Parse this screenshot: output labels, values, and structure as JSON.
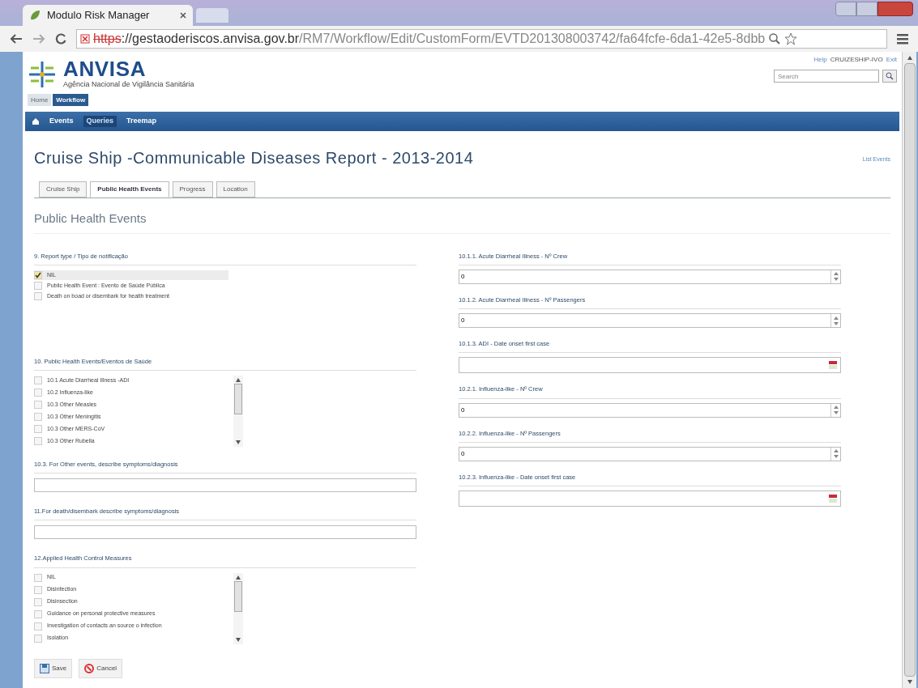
{
  "browser": {
    "tab_title": "Modulo Risk Manager",
    "url_scheme": "https",
    "url_host": "://gestaoderiscos.anvisa.gov.br",
    "url_path": "/RM7/Workflow/Edit/CustomForm/EVTD201308003742/fa64fcfe-6da1-42e5-8dbb"
  },
  "header": {
    "logo": "ANVISA",
    "subtitle": "Agência Nacional de Vigilância Sanitária",
    "help": "Help",
    "user": "CRUIZESHIP-IVO",
    "exit": "Exit",
    "search_placeholder": "Search"
  },
  "top_tabs": [
    {
      "label": "Home",
      "selected": false
    },
    {
      "label": "Workflow",
      "selected": true
    }
  ],
  "menu": [
    {
      "label": "Events",
      "selected": false
    },
    {
      "label": "Queries",
      "selected": true
    },
    {
      "label": "Treemap",
      "selected": false
    }
  ],
  "page_title": "Cruise Ship -Communicable Diseases Report - 2013-2014",
  "list_events_link": "List Events",
  "tabs": [
    {
      "label": "Cruise Ship",
      "selected": false
    },
    {
      "label": "Public Health Events",
      "selected": true
    },
    {
      "label": "Progress",
      "selected": false
    },
    {
      "label": "Location",
      "selected": false
    }
  ],
  "section_title": "Public Health Events",
  "left": [
    {
      "kind": "checks",
      "label": "9. Report type / Tipo de notificação",
      "items": [
        {
          "label": "NIL",
          "checked": true
        },
        {
          "label": "Public Health Event : Evento de Saúde Pública",
          "checked": false
        },
        {
          "label": "Death on boad or disembark for health treatment",
          "checked": false
        }
      ]
    },
    {
      "kind": "scrolllist",
      "label": "10. Public Health Events/Eventos de Saúde",
      "items": [
        {
          "label": "10.1 Acute Diarrheal Illness -ADI",
          "checked": false
        },
        {
          "label": "10.2 Influenza-like",
          "checked": false
        },
        {
          "label": "10.3 Other Measles",
          "checked": false
        },
        {
          "label": "10.3 Other Meningitis",
          "checked": false
        },
        {
          "label": "10.3 Other MERS-CoV",
          "checked": false
        },
        {
          "label": "10.3 Other Rubella",
          "checked": false
        }
      ]
    },
    {
      "kind": "text",
      "label": "10.3. For Other events, describe symptoms/diagnosis"
    },
    {
      "kind": "text",
      "label": "11.For death/disembark describe symptoms/diagnosis"
    },
    {
      "kind": "scrolllist",
      "label": "12.Applied Health Control Measures",
      "items": [
        {
          "label": "NIL",
          "checked": false
        },
        {
          "label": "Disinfection",
          "checked": false
        },
        {
          "label": "Disinsection",
          "checked": false
        },
        {
          "label": "Guidance on personal protective measures",
          "checked": false
        },
        {
          "label": "Investigation of contacts an source o infection",
          "checked": false
        },
        {
          "label": "Isolation",
          "checked": false
        }
      ]
    }
  ],
  "right": [
    {
      "kind": "number",
      "label": "10.1.1. Acute Diarrheal Illness - Nº Crew",
      "value": "0"
    },
    {
      "kind": "number",
      "label": "10.1.2. Acute Diarrheal Illness - Nº Passengers",
      "value": "0"
    },
    {
      "kind": "date",
      "label": "10.1.3. ADI - Date onset first case"
    },
    {
      "kind": "number",
      "label": "10.2.1. Influenza-like - Nº Crew",
      "value": "0"
    },
    {
      "kind": "number",
      "label": "10.2.2. Influenza-like - Nº Passengers",
      "value": "0"
    },
    {
      "kind": "date",
      "label": "10.2.3. Influenza-like - Date onset first case"
    }
  ],
  "buttons": [
    {
      "kind": "save",
      "label": "Save"
    },
    {
      "kind": "cancel",
      "label": "Cancel"
    }
  ]
}
